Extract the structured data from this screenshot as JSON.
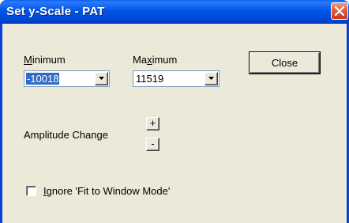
{
  "window": {
    "title": "Set y-Scale - PAT"
  },
  "minimum": {
    "label_first": "M",
    "label_rest": "inimum",
    "value": "-10018"
  },
  "maximum": {
    "label_pre": "Ma",
    "label_u": "x",
    "label_post": "imum",
    "value": "11519"
  },
  "close_button": {
    "label": "Close"
  },
  "amplitude": {
    "label": "Amplitude Change",
    "increase_label": "+",
    "decrease_label": "-"
  },
  "ignore_fit": {
    "label_first": "I",
    "label_rest": "gnore 'Fit to Window Mode'",
    "checked": false
  },
  "icons": {
    "close": "close-icon",
    "dropdown": "chevron-down-icon"
  },
  "colors": {
    "titlebar": "#0055e6",
    "dialog_bg": "#ece9d8",
    "selection": "#316ac5",
    "close_red": "#e2613f"
  }
}
